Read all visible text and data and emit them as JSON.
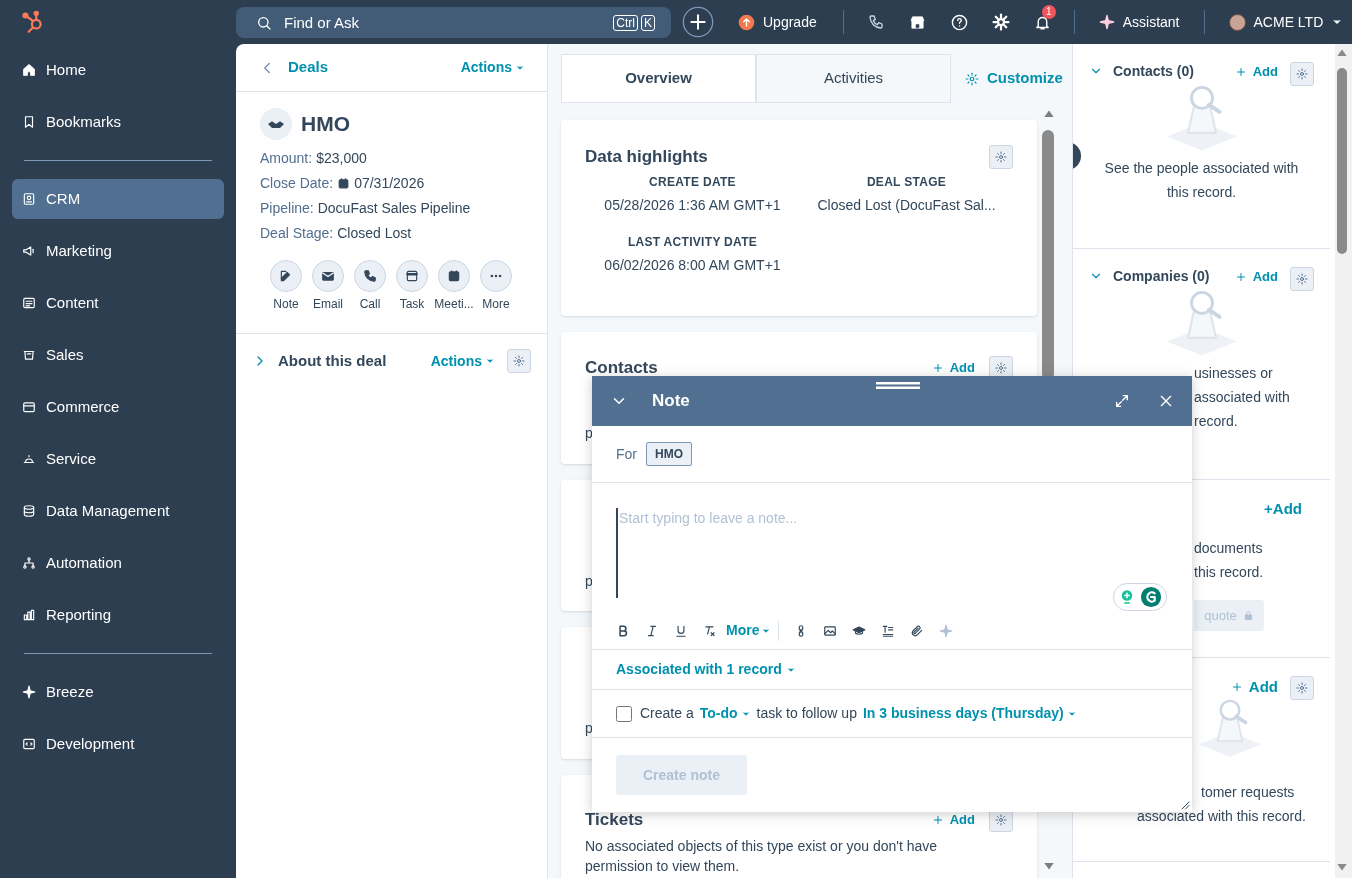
{
  "top_bar": {
    "search": {
      "placeholder": "Find or Ask",
      "shortcut": [
        "Ctrl",
        "K"
      ]
    },
    "upgrade": "Upgrade",
    "notifications": "1",
    "assistant": "Assistant",
    "account": "ACME LTD"
  },
  "sidebar": {
    "items": [
      {
        "label": "Home",
        "kind": "home",
        "selected": false
      },
      {
        "label": "Bookmarks",
        "kind": "bookmark",
        "selected": false
      },
      {
        "label": "CRM",
        "kind": "crm",
        "selected": true,
        "group_start": true
      },
      {
        "label": "Marketing",
        "kind": "marketing",
        "selected": false
      },
      {
        "label": "Content",
        "kind": "content",
        "selected": false
      },
      {
        "label": "Sales",
        "kind": "sales",
        "selected": false
      },
      {
        "label": "Commerce",
        "kind": "commerce",
        "selected": false
      },
      {
        "label": "Service",
        "kind": "service",
        "selected": false
      },
      {
        "label": "Data Management",
        "kind": "data",
        "selected": false
      },
      {
        "label": "Automation",
        "kind": "automation",
        "selected": false
      },
      {
        "label": "Reporting",
        "kind": "reporting",
        "selected": false
      },
      {
        "label": "Breeze",
        "kind": "breeze",
        "selected": false,
        "group_start": true
      },
      {
        "label": "Development",
        "kind": "development",
        "selected": false
      }
    ]
  },
  "record": {
    "back": "Deals",
    "actions": "Actions",
    "title": "HMO",
    "properties": [
      {
        "label": "Amount:",
        "value": "$23,000"
      },
      {
        "label": "Close Date:",
        "value": "07/31/2026",
        "kind": "date"
      },
      {
        "label": "Pipeline:",
        "value": "DocuFast Sales Pipeline"
      },
      {
        "label": "Deal Stage:",
        "value": "Closed Lost"
      }
    ],
    "quick_actions": [
      {
        "label": "Note",
        "kind": "note"
      },
      {
        "label": "Email",
        "kind": "email"
      },
      {
        "label": "Call",
        "kind": "call"
      },
      {
        "label": "Task",
        "kind": "task"
      },
      {
        "label": "Meeti...",
        "kind": "meeting"
      },
      {
        "label": "More",
        "kind": "more"
      }
    ],
    "about": {
      "title": "About this deal",
      "actions": "Actions",
      "expanded": false
    }
  },
  "tabs": [
    {
      "label": "Overview",
      "selected": true
    },
    {
      "label": "Activities",
      "selected": false
    }
  ],
  "customize": "Customize",
  "data_highlights": {
    "title": "Data highlights",
    "fields": [
      {
        "label": "CREATE DATE",
        "value": "05/28/2026 1:36 AM GMT+1"
      },
      {
        "label": "DEAL STAGE",
        "value": "Closed Lost (DocuFast Sal..."
      },
      {
        "label": "LAST ACTIVITY DATE",
        "value": "06/02/2026 8:00 AM GMT+1"
      }
    ]
  },
  "cards": [
    {
      "title": "Contacts",
      "add": "Add",
      "lines": [
        "p"
      ]
    },
    {
      "lines": [
        "p"
      ]
    },
    {
      "lines": [
        "p"
      ]
    },
    {
      "title": "Tickets",
      "add": "Add",
      "lines": [
        "No associated objects of this type exist or you don't have",
        "permission to view them."
      ]
    }
  ],
  "right_sections": [
    {
      "title": "Contacts (0)",
      "add": "Add",
      "expanded": true,
      "lines": [
        "See the people associated with",
        "this record."
      ]
    },
    {
      "title": "Companies (0)",
      "add": "Add",
      "expanded": true,
      "lines": [
        "usinesses or",
        "associated with",
        "record."
      ]
    },
    {
      "add": "+Add",
      "lines": [
        "documents",
        "this record."
      ],
      "button": "quote"
    },
    {
      "add": "Add",
      "lines": [
        "tomer requests",
        "associated with this record."
      ]
    }
  ],
  "note": {
    "title": "Note",
    "for_label": "For",
    "record_tag": "HMO",
    "placeholder": "Start typing to leave a note...",
    "more": "More",
    "associated": "Associated with 1 record",
    "task": {
      "checked": false,
      "parts": [
        "Create a",
        "To-do",
        "task to follow up",
        "In 3 business days (Thursday)"
      ]
    },
    "create": {
      "label": "Create note",
      "disabled": true
    }
  }
}
